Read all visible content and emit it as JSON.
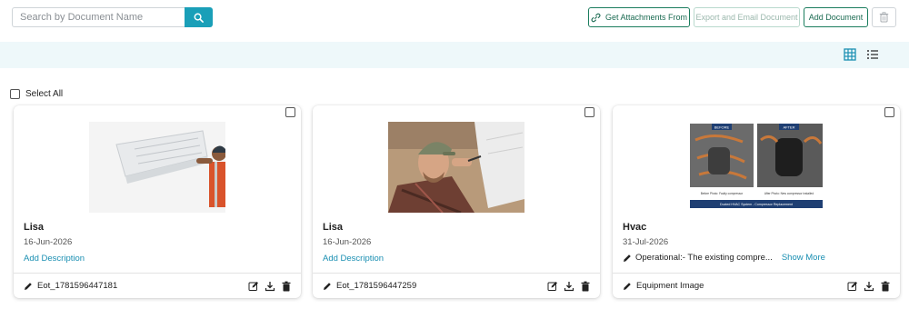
{
  "search": {
    "placeholder": "Search by Document Name",
    "button_icon": "search-icon"
  },
  "toolbar": {
    "get_attachments_label": "Get Attachments From",
    "export_email_label": "Export and Email Document",
    "add_document_label": "Add Document",
    "delete_icon": "trash-icon"
  },
  "view": {
    "grid_icon": "grid-view-icon",
    "list_icon": "list-view-icon",
    "active": "grid"
  },
  "select_all_label": "Select All",
  "colors": {
    "accent": "#1a9fb8",
    "brand_green": "#1b7d5e",
    "link": "#1a8fb2",
    "viewbar_bg": "#eef8fa"
  },
  "documents": [
    {
      "title": "Lisa",
      "date": "16-Jun-2026",
      "add_description": "Add Description",
      "filename": "Eot_1781596447181"
    },
    {
      "title": "Lisa",
      "date": "16-Jun-2026",
      "add_description": "Add Description",
      "filename": "Eot_1781596447259"
    },
    {
      "title": "Hvac",
      "date": "31-Jul-2026",
      "description": "Operational:- The existing compre...",
      "show_more": "Show More",
      "filename": "Equipment Image",
      "image_text": {
        "before_tag": "BEFORE",
        "after_tag": "AFTER",
        "before_caption": "Before Photo: Faulty compressor",
        "after_caption": "After Photo: New compressor installed",
        "banner": "Ducted HVAC System - Compressor Replacement"
      }
    }
  ]
}
